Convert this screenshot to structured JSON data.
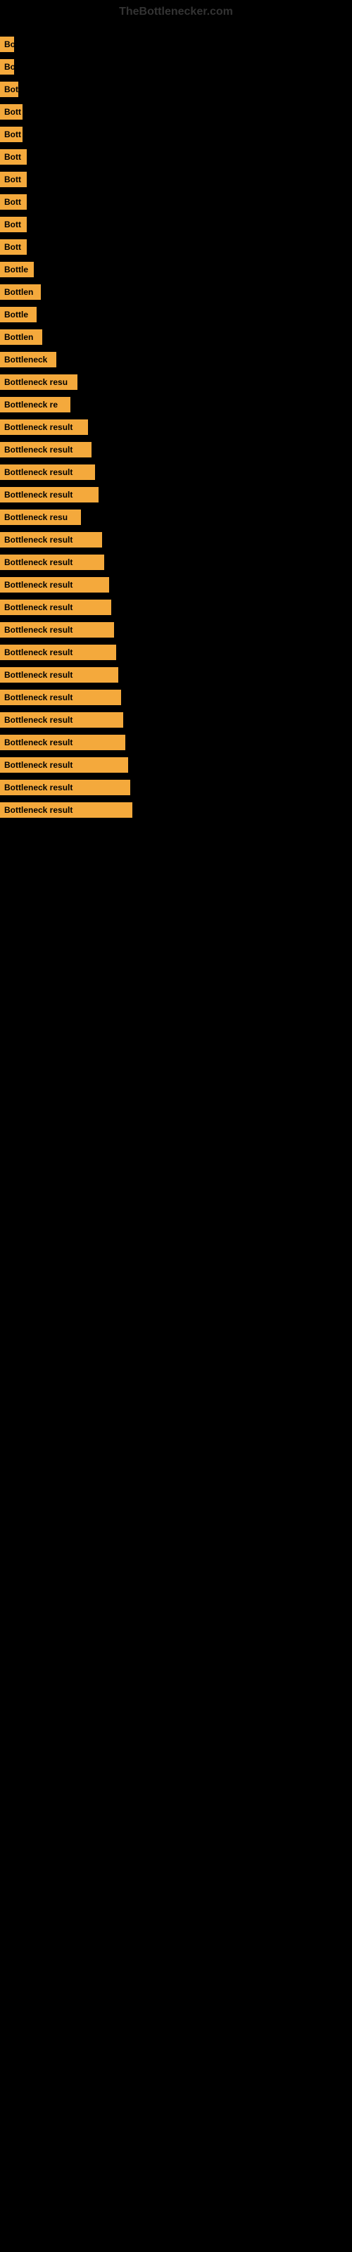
{
  "header": {
    "title": "TheBottlenecker.com"
  },
  "items": [
    {
      "id": 1,
      "text": "Bo",
      "width": 20
    },
    {
      "id": 2,
      "text": "Bo",
      "width": 20
    },
    {
      "id": 3,
      "text": "Bot",
      "width": 26
    },
    {
      "id": 4,
      "text": "Bott",
      "width": 32
    },
    {
      "id": 5,
      "text": "Bott",
      "width": 32
    },
    {
      "id": 6,
      "text": "Bott",
      "width": 38
    },
    {
      "id": 7,
      "text": "Bott",
      "width": 38
    },
    {
      "id": 8,
      "text": "Bott",
      "width": 38
    },
    {
      "id": 9,
      "text": "Bott",
      "width": 38
    },
    {
      "id": 10,
      "text": "Bott",
      "width": 38
    },
    {
      "id": 11,
      "text": "Bottle",
      "width": 48
    },
    {
      "id": 12,
      "text": "Bottlen",
      "width": 58
    },
    {
      "id": 13,
      "text": "Bottle",
      "width": 52
    },
    {
      "id": 14,
      "text": "Bottlen",
      "width": 60
    },
    {
      "id": 15,
      "text": "Bottleneck",
      "width": 80
    },
    {
      "id": 16,
      "text": "Bottleneck resu",
      "width": 110
    },
    {
      "id": 17,
      "text": "Bottleneck re",
      "width": 100
    },
    {
      "id": 18,
      "text": "Bottleneck result",
      "width": 125
    },
    {
      "id": 19,
      "text": "Bottleneck result",
      "width": 130
    },
    {
      "id": 20,
      "text": "Bottleneck result",
      "width": 135
    },
    {
      "id": 21,
      "text": "Bottleneck result",
      "width": 140
    },
    {
      "id": 22,
      "text": "Bottleneck resu",
      "width": 115
    },
    {
      "id": 23,
      "text": "Bottleneck result",
      "width": 145
    },
    {
      "id": 24,
      "text": "Bottleneck result",
      "width": 148
    },
    {
      "id": 25,
      "text": "Bottleneck result",
      "width": 155
    },
    {
      "id": 26,
      "text": "Bottleneck result",
      "width": 158
    },
    {
      "id": 27,
      "text": "Bottleneck result",
      "width": 162
    },
    {
      "id": 28,
      "text": "Bottleneck result",
      "width": 165
    },
    {
      "id": 29,
      "text": "Bottleneck result",
      "width": 168
    },
    {
      "id": 30,
      "text": "Bottleneck result",
      "width": 172
    },
    {
      "id": 31,
      "text": "Bottleneck result",
      "width": 175
    },
    {
      "id": 32,
      "text": "Bottleneck result",
      "width": 178
    },
    {
      "id": 33,
      "text": "Bottleneck result",
      "width": 182
    },
    {
      "id": 34,
      "text": "Bottleneck result",
      "width": 185
    },
    {
      "id": 35,
      "text": "Bottleneck result",
      "width": 188
    }
  ]
}
